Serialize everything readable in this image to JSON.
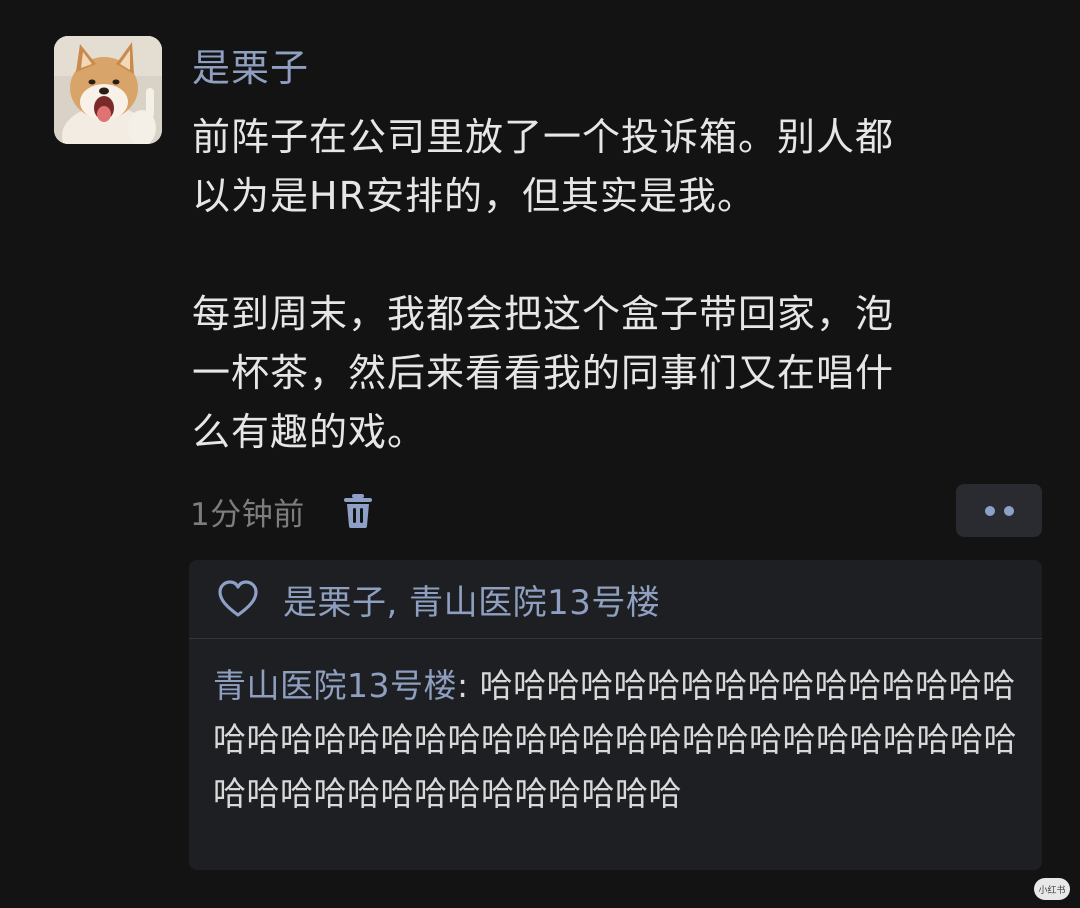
{
  "post": {
    "username": "是栗子",
    "content": "前阵子在公司里放了一个投诉箱。别人都\n以为是HR安排的，但其实是我。\n\n每到周末，我都会把这个盒子带回家，泡\n一杯茶，然后来看看我的同事们又在唱什\n么有趣的戏。",
    "time": "1分钟前"
  },
  "reply_box": {
    "likes": "是栗子, 青山医院13号楼",
    "comment": {
      "author": "青山医院13号楼",
      "separator": ": ",
      "text": "哈哈哈哈哈哈哈哈哈哈哈哈哈哈哈哈哈哈哈哈哈哈哈哈哈哈哈哈哈哈哈哈哈哈哈哈哈哈哈哈哈哈哈哈哈哈哈哈哈哈哈哈哈哈"
    }
  },
  "watermark": {
    "text": "小红书"
  },
  "colors": {
    "background": "#131313",
    "name_blue": "#8e9fc0",
    "text": "#e6e6e6",
    "muted": "#7d7d7d",
    "panel": "#1e1f22"
  },
  "icons": {
    "delete": "trash-icon",
    "more": "more-dots-icon",
    "like": "heart-outline-icon"
  }
}
